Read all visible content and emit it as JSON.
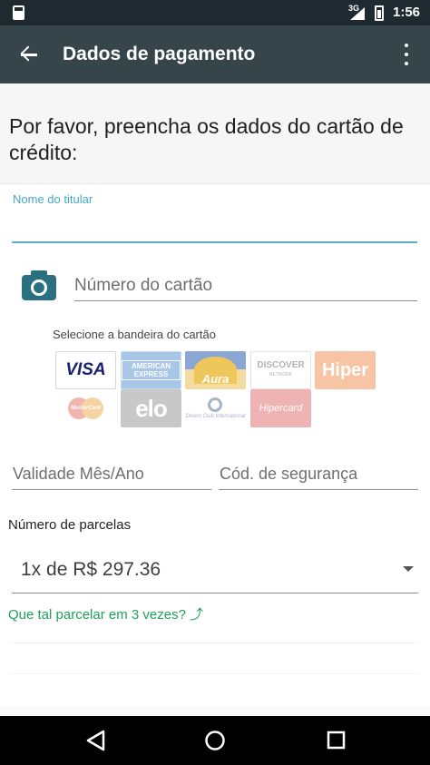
{
  "status_bar": {
    "network": "3G",
    "time": "1:56"
  },
  "app_bar": {
    "title": "Dados de pagamento"
  },
  "form": {
    "intro": "Por favor, preencha os dados do cartão de crédito:",
    "holder_label": "Nome do titular",
    "card_number_placeholder": "Número do cartão",
    "brand_caption": "Selecione a bandeira do cartão",
    "brands": [
      {
        "name": "VISA",
        "selected": true
      },
      {
        "name": "AMERICAN EXPRESS",
        "selected": false
      },
      {
        "name": "Aura",
        "selected": false
      },
      {
        "name": "DISCOVER",
        "sub": "NETWORK",
        "selected": false
      },
      {
        "name": "Hiper",
        "selected": false
      },
      {
        "name": "MasterCard",
        "selected": false
      },
      {
        "name": "elo",
        "selected": false
      },
      {
        "name": "Diners Club International",
        "selected": false
      },
      {
        "name": "Hipercard",
        "selected": false
      }
    ],
    "validity_placeholder": "Validade Mês/Ano",
    "cvv_placeholder": "Cód. de segurança",
    "installments_label": "Número de parcelas",
    "installments_value": "1x de R$ 297.36",
    "installment_suggestion": "Que tal parcelar em 3 vezes? ⤴"
  },
  "colors": {
    "app_bar": "#354549",
    "status_bar": "#1e2a30",
    "accent": "#46a9c8",
    "camera": "#2a7081",
    "link": "#20a05a"
  }
}
